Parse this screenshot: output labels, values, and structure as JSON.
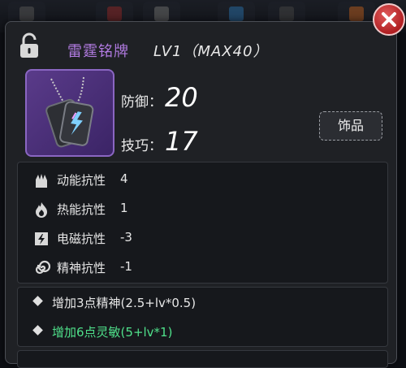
{
  "item": {
    "name": "雷霆铭牌",
    "level": "LV1（MAX40）"
  },
  "stats": {
    "defense_label": "防御：",
    "defense_value": "20",
    "skill_label": "技巧：",
    "skill_value": "17"
  },
  "tag_button": "饰品",
  "resistances": [
    {
      "icon": "kinetic-icon",
      "label": "动能抗性",
      "value": "4"
    },
    {
      "icon": "fire-icon",
      "label": "热能抗性",
      "value": "1"
    },
    {
      "icon": "lightning-icon",
      "label": "电磁抗性",
      "value": "-3"
    },
    {
      "icon": "spiral-icon",
      "label": "精神抗性",
      "value": "-1"
    }
  ],
  "effects": [
    {
      "text": "增加3点精神(2.5+lv*0.5)",
      "active": false
    },
    {
      "text": "增加6点灵敏(5+lv*1)",
      "active": true
    }
  ],
  "colors": {
    "name": "#b07ae0",
    "active_effect": "#4fe08a",
    "rarity_frame": "#5a3b8a",
    "close_button": "#b01f22"
  }
}
